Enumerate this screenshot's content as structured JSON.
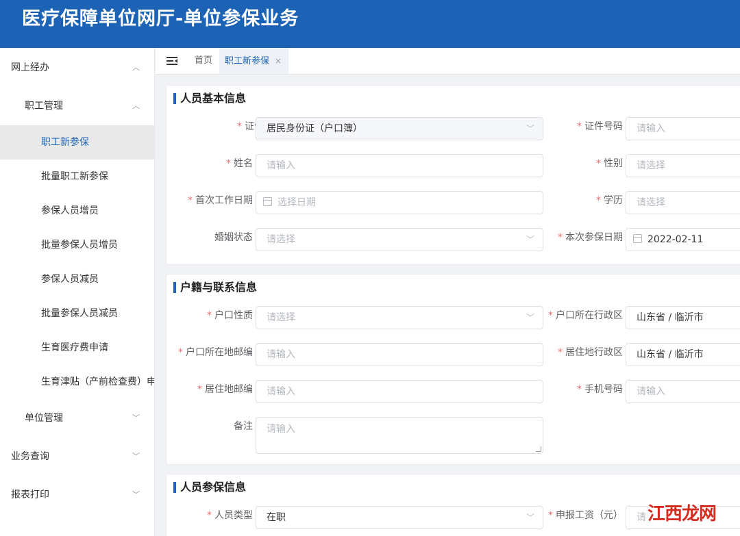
{
  "header": {
    "title": "医疗保障单位网厅-单位参保业务"
  },
  "sidebar": {
    "items": [
      {
        "label": "网上经办",
        "arrow": "︿"
      },
      {
        "label": "职工管理",
        "arrow": "︿"
      },
      {
        "label": "职工新参保"
      },
      {
        "label": "批量职工新参保"
      },
      {
        "label": "参保人员增员"
      },
      {
        "label": "批量参保人员增员"
      },
      {
        "label": "参保人员减员"
      },
      {
        "label": "批量参保人员减员"
      },
      {
        "label": "生育医疗费申请"
      },
      {
        "label": "生育津贴（产前检查费）申"
      },
      {
        "label": "单位管理",
        "arrow": "﹀"
      },
      {
        "label": "业务查询",
        "arrow": "﹀"
      },
      {
        "label": "报表打印",
        "arrow": "﹀"
      }
    ]
  },
  "tabs": {
    "home": "首页",
    "active": "职工新参保",
    "close": "×"
  },
  "sections": {
    "basic": {
      "title": "人员基本信息",
      "id_type_label": "证件类型",
      "id_type_value": "居民身份证（户口簿）",
      "id_number_label": "证件号码",
      "id_number_ph": "请输入",
      "name_label": "姓名",
      "name_ph": "请输入",
      "gender_label": "性别",
      "gender_ph": "请选择",
      "first_work_label": "首次工作日期",
      "first_work_ph": "选择日期",
      "education_label": "学历",
      "education_ph": "请选择",
      "marital_label": "婚姻状态",
      "marital_ph": "请选择",
      "insure_date_label": "本次参保日期",
      "insure_date_value": "2022-02-11"
    },
    "household": {
      "title": "户籍与联系信息",
      "hukou_type_label": "户口性质",
      "hukou_type_ph": "请选择",
      "hukou_region_label": "户口所在行政区",
      "hukou_region_value": "山东省 / 临沂市",
      "hukou_zip_label": "户口所在地邮编",
      "hukou_zip_ph": "请输入",
      "res_region_label": "居住地行政区",
      "res_region_value": "山东省 / 临沂市",
      "res_zip_label": "居住地邮编",
      "res_zip_ph": "请输入",
      "mobile_label": "手机号码",
      "mobile_ph": "请输入",
      "remark_label": "备注",
      "remark_ph": "请输入"
    },
    "insurance": {
      "title": "人员参保信息",
      "person_type_label": "人员类型",
      "person_type_value": "在职",
      "wage_label": "申报工资（元）",
      "wage_ph": "请"
    }
  },
  "required_mark": "*",
  "watermark": "江西龙网"
}
